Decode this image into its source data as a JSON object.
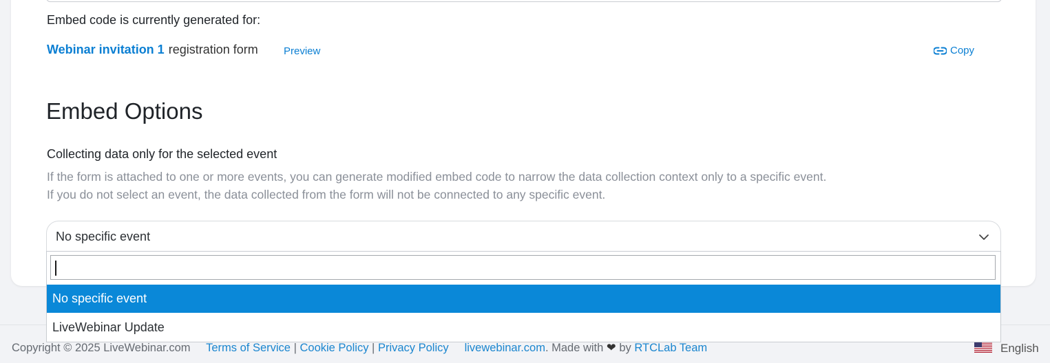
{
  "embed": {
    "status_text": "Embed code is currently generated for:",
    "form_name": "Webinar invitation 1",
    "form_suffix": "registration form",
    "preview_label": "Preview",
    "copy_label": "Copy"
  },
  "options": {
    "title": "Embed Options",
    "subheading": "Collecting data only for the selected event",
    "description_line1": "If the form is attached to one or more events, you can generate modified embed code to narrow the data collection context only to a specific event.",
    "description_line2": "If you do not select an event, the data collected from the form will not be connected to any specific event.",
    "select": {
      "selected_value": "No specific event",
      "search_value": "",
      "options": [
        {
          "label": "No specific event",
          "selected": true
        },
        {
          "label": "LiveWebinar Update",
          "selected": false
        }
      ]
    }
  },
  "footer": {
    "copyright": "Copyright © 2025 LiveWebinar.com",
    "terms": "Terms of Service",
    "cookie": "Cookie Policy",
    "privacy": "Privacy Policy",
    "site_link": "livewebinar.com",
    "made_with": ". Made with",
    "by": "by",
    "team": "RTCLab Team",
    "separator": "|",
    "language": "English"
  },
  "colors": {
    "accent": "#0b7fd3",
    "selected_option_bg": "#0a88d8",
    "muted_text": "#8a8f98"
  },
  "icons": {
    "copy": "link-icon",
    "select": "chevron-down-icon",
    "language": "us-flag-icon",
    "heart": "heart-icon"
  }
}
